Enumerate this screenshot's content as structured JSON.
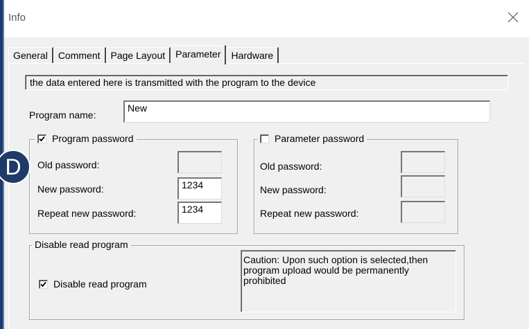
{
  "window": {
    "title": "Info"
  },
  "tabs": [
    {
      "label": "General"
    },
    {
      "label": "Comment"
    },
    {
      "label": "Page Layout"
    },
    {
      "label": "Parameter"
    },
    {
      "label": "Hardware"
    }
  ],
  "info_text": "the data entered here is transmitted  with the  program  to the device",
  "program_name": {
    "label": "Program name:",
    "value": "New"
  },
  "program_password": {
    "legend": "Program password",
    "checked": true,
    "old_label": "Old password:",
    "new_label": "New password:",
    "repeat_label": "Repeat new password:",
    "old_value": "",
    "new_value": "1234",
    "repeat_value": "1234"
  },
  "parameter_password": {
    "legend": "Parameter password",
    "checked": false,
    "old_label": "Old password:",
    "new_label": "New password:",
    "repeat_label": "Repeat new password:"
  },
  "disable_read": {
    "legend": "Disable read program",
    "checkbox_label": "Disable read program",
    "checked": true,
    "caution": "Caution: Upon such option is selected,then program upload would be permanently prohibited"
  },
  "badge": {
    "letter": "D"
  },
  "icons": {
    "close": "close-icon",
    "check": "checkmark-icon"
  },
  "colors": {
    "background": "#1f3a68",
    "dialog": "#f0f0f0"
  }
}
